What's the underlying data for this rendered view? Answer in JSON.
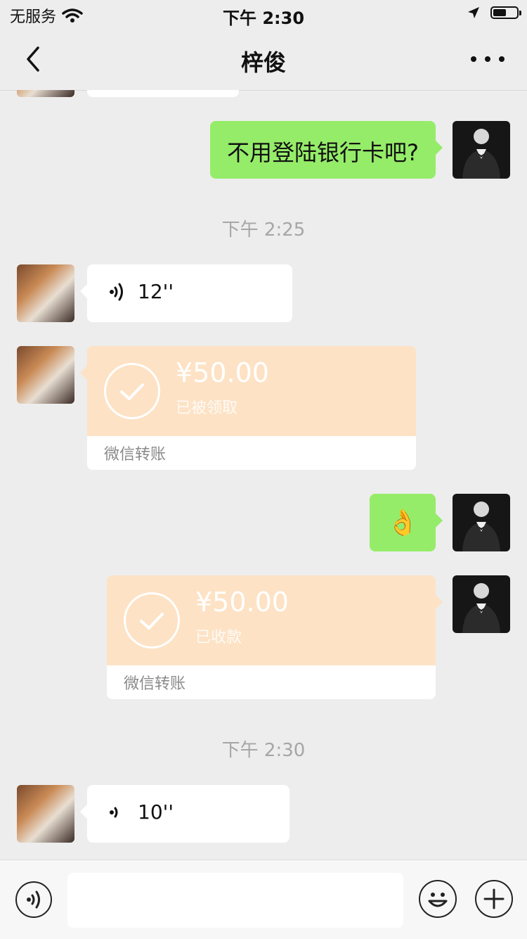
{
  "status_bar": {
    "carrier": "无服务",
    "time": "下午 2:30",
    "battery_level": 0.55
  },
  "header": {
    "title": "梓俊",
    "back_icon": "chevron-left-icon",
    "more_icon": "more-dots-icon"
  },
  "messages": {
    "m1_text": "不用登陆银行卡吧?",
    "ts1": "下午 2:25",
    "voice1_duration": "12''",
    "transfer1": {
      "amount": "¥50.00",
      "status": "已被领取",
      "label": "微信转账"
    },
    "m2_emoji": "👌",
    "transfer2": {
      "amount": "¥50.00",
      "status": "已收款",
      "label": "微信转账"
    },
    "ts2": "下午 2:30",
    "voice2_duration": "10''"
  },
  "input_bar": {
    "placeholder": "",
    "voice_icon": "voice-icon",
    "emoji_icon": "emoji-icon",
    "plus_icon": "plus-icon"
  },
  "colors": {
    "sent_bubble": "#95ec69",
    "received_bubble": "#ffffff",
    "transfer_bg": "#fde2c5",
    "background": "#ededed"
  }
}
